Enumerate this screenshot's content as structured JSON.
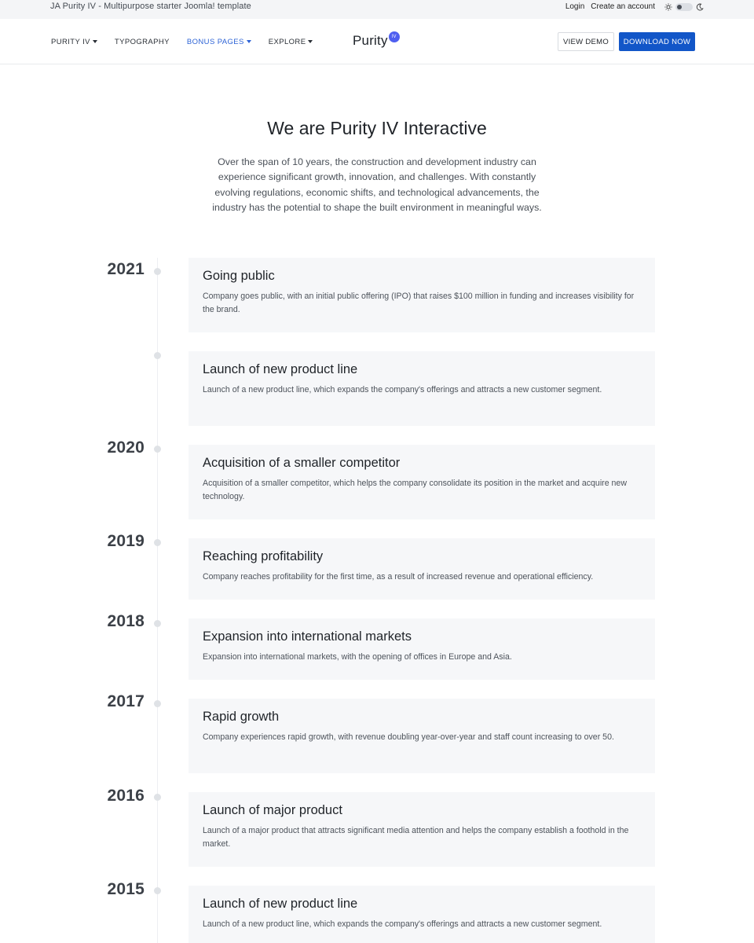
{
  "topbar": {
    "tagline": "JA Purity IV - Multipurpose starter Joomla! template",
    "login": "Login",
    "create_account": "Create an account"
  },
  "nav": {
    "items": [
      {
        "label": "PURITY IV",
        "dropdown": true
      },
      {
        "label": "TYPOGRAPHY",
        "dropdown": false
      },
      {
        "label": "BONUS PAGES",
        "dropdown": true,
        "active": true
      },
      {
        "label": "EXPLORE",
        "dropdown": true
      }
    ],
    "logo_text": "Purity",
    "logo_badge": "IV",
    "view_demo": "VIEW DEMO",
    "download_now": "DOWNLOAD NOW"
  },
  "colors": {
    "accent": "#1256c8",
    "active_nav": "#2d63d6",
    "logo_badge": "#4f5ff0",
    "card_bg": "#f6f7f9"
  },
  "intro": {
    "title": "We are Purity IV Interactive",
    "text": "Over the span of 10 years, the construction and development industry can experience significant growth, innovation, and challenges. With constantly evolving regulations, economic shifts, and technological advancements, the industry has the potential to shape the built environment in meaningful ways."
  },
  "timeline": [
    {
      "year": "2021",
      "title": "Going public",
      "desc": "Company goes public, with an initial public offering (IPO) that raises $100 million in funding and increases visibility for the brand."
    },
    {
      "year": "",
      "title": "Launch of new product line",
      "desc": "Launch of a new product line, which expands the company's offerings and attracts a new customer segment."
    },
    {
      "year": "2020",
      "title": "Acquisition of a smaller competitor",
      "desc": "Acquisition of a smaller competitor, which helps the company consolidate its position in the market and acquire new technology."
    },
    {
      "year": "2019",
      "title": "Reaching profitability",
      "desc": "Company reaches profitability for the first time, as a result of increased revenue and operational efficiency."
    },
    {
      "year": "2018",
      "title": "Expansion into international markets",
      "desc": "Expansion into international markets, with the opening of offices in Europe and Asia."
    },
    {
      "year": "2017",
      "title": "Rapid growth",
      "desc": "Company experiences rapid growth, with revenue doubling year-over-year and staff count increasing to over 50."
    },
    {
      "year": "2016",
      "title": "Launch of major product",
      "desc": "Launch of a major product that attracts significant media attention and helps the company establish a foothold in the market."
    },
    {
      "year": "2015",
      "title": "Launch of new product line",
      "desc": "Launch of a new product line, which expands the company's offerings and attracts a new customer segment."
    }
  ]
}
